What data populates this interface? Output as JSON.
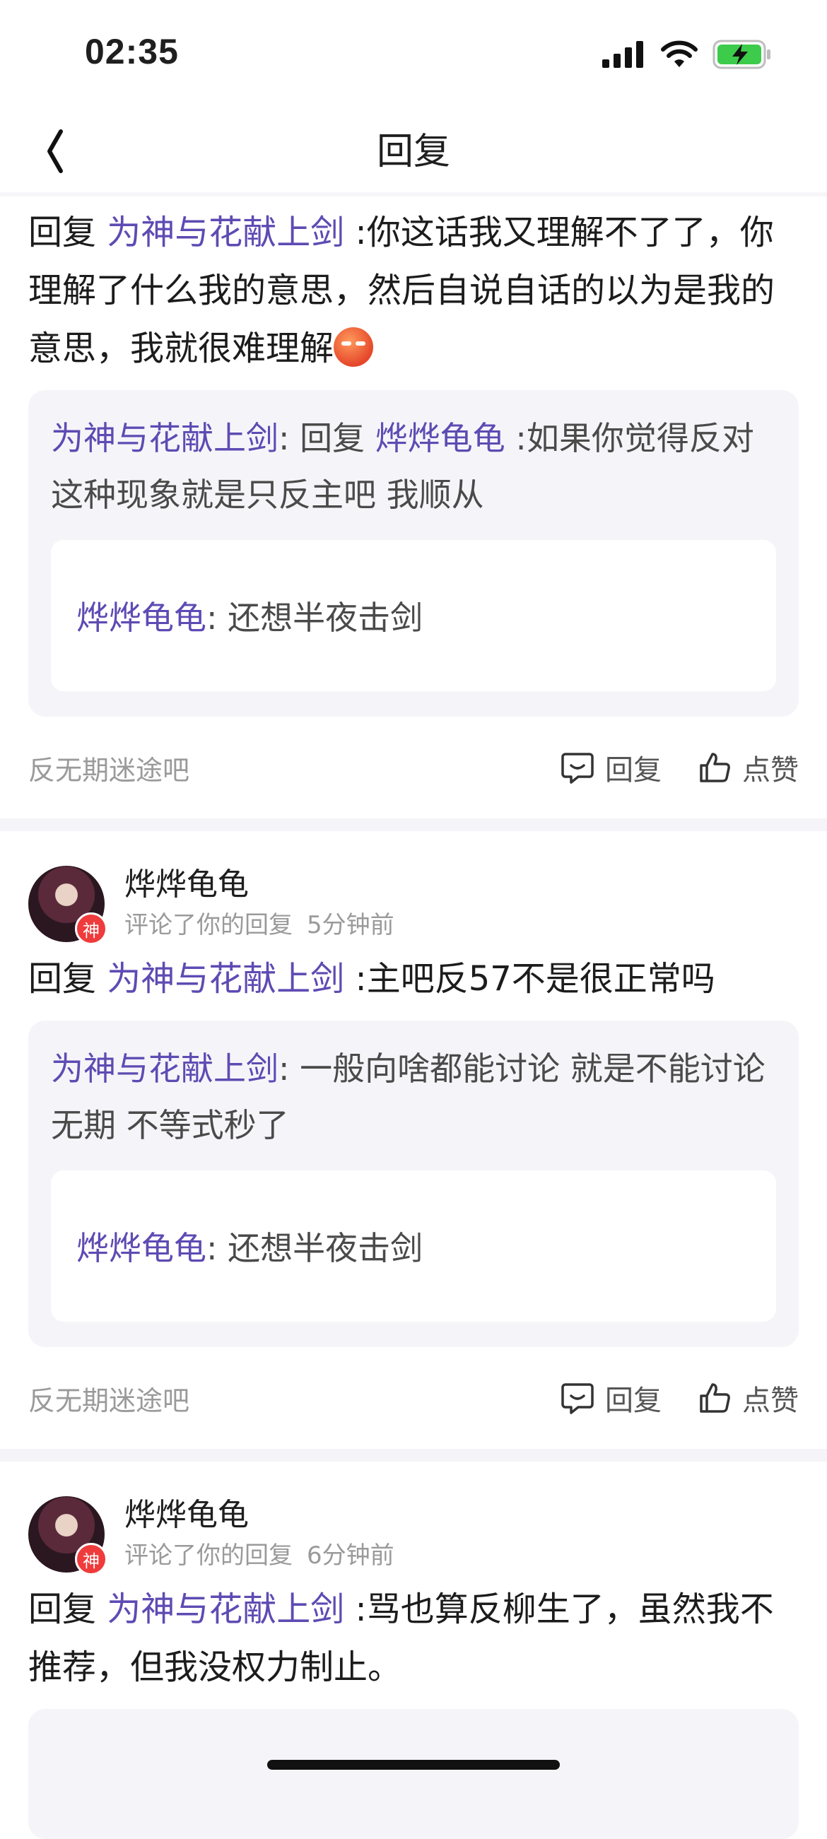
{
  "status_bar": {
    "time": "02:35"
  },
  "header": {
    "title": "回复"
  },
  "reply_prefix": "回复 ",
  "items": [
    {
      "reply_to": "为神与花献上剑",
      "text": " :你这话我又理解不了了，你理解了什么我的意思，然后自说自话的以为是我的意思，我就很难理解",
      "quote": {
        "author": "为神与花献上剑",
        "sep": ": 回复 ",
        "reply_to": "烨烨龟龟",
        "text": " :如果你觉得反对这种现象就是只反主吧 我顺从"
      },
      "inner": {
        "author": "烨烨龟龟",
        "text": ": 还想半夜击剑"
      },
      "forum": "反无期迷途吧",
      "reply_label": "回复",
      "like_label": "点赞"
    },
    {
      "author": "烨烨龟龟",
      "badge": "神",
      "action_text": "评论了你的回复",
      "time": "5分钟前",
      "reply_to": "为神与花献上剑",
      "text": " :主吧反57不是很正常吗",
      "quote": {
        "author": "为神与花献上剑",
        "text": ": 一般向啥都能讨论 就是不能讨论无期 不等式秒了"
      },
      "inner": {
        "author": "烨烨龟龟",
        "text": ": 还想半夜击剑"
      },
      "forum": "反无期迷途吧",
      "reply_label": "回复",
      "like_label": "点赞"
    },
    {
      "author": "烨烨龟龟",
      "badge": "神",
      "action_text": "评论了你的回复",
      "time": "6分钟前",
      "reply_to": "为神与花献上剑",
      "text": " :骂也算反柳生了，虽然我不推荐，但我没权力制止。"
    }
  ],
  "colors": {
    "username": "#5e4bb3",
    "divider": "#f5f5f9",
    "badge": "#ef3b3b"
  }
}
